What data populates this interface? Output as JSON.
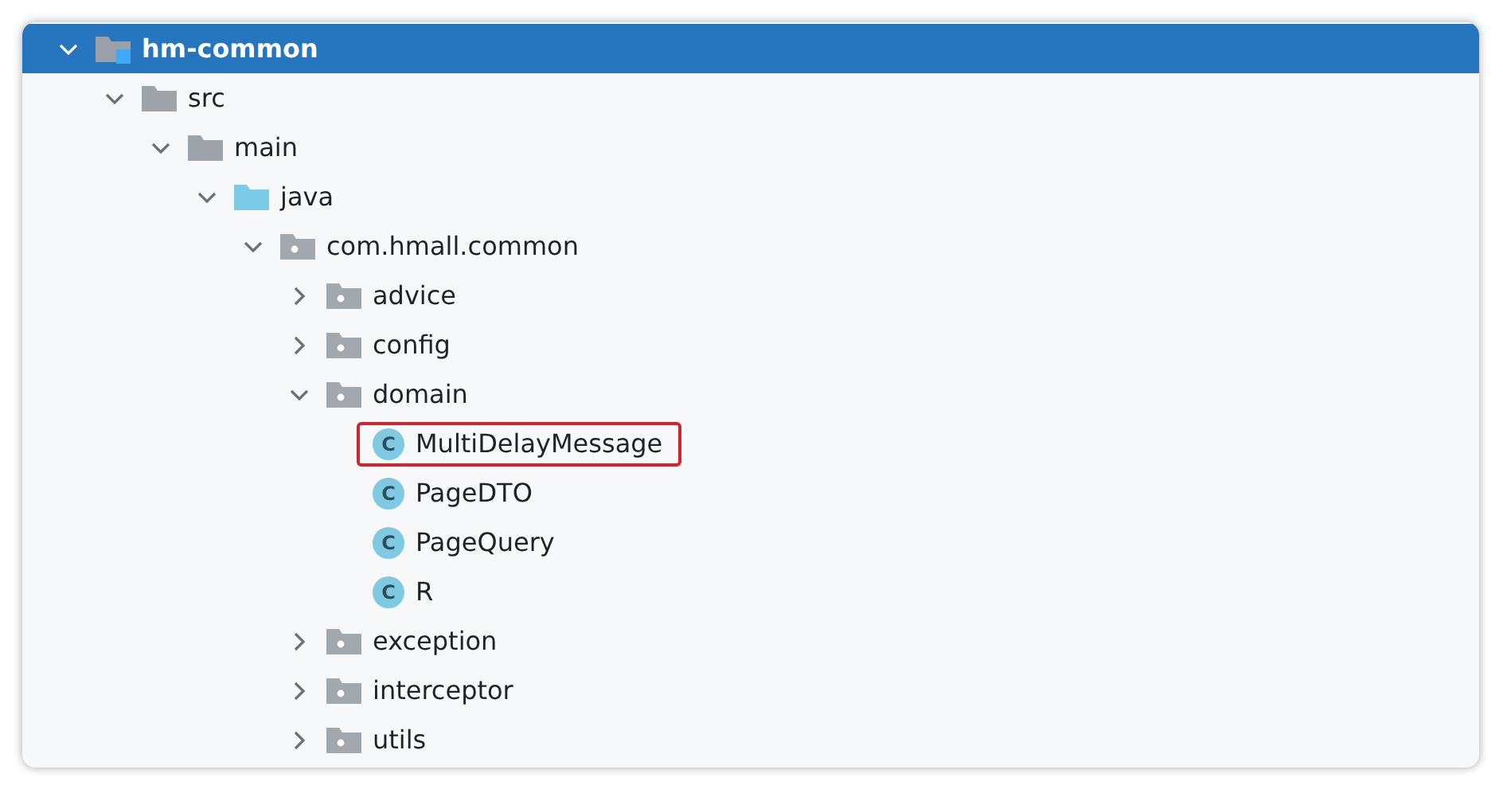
{
  "project_tree": {
    "root": {
      "kind": "module",
      "name": "hm-common",
      "expanded": true,
      "selected": true,
      "children": [
        {
          "kind": "folder",
          "name": "src",
          "expanded": true,
          "selected": false,
          "children": [
            {
              "kind": "folder",
              "name": "main",
              "expanded": true,
              "selected": false,
              "children": [
                {
                  "kind": "source_root",
                  "name": "java",
                  "expanded": true,
                  "selected": false,
                  "children": [
                    {
                      "kind": "package",
                      "name": "com.hmall.common",
                      "expanded": true,
                      "selected": false,
                      "children": [
                        {
                          "kind": "package",
                          "name": "advice",
                          "expanded": false,
                          "selected": false
                        },
                        {
                          "kind": "package",
                          "name": "config",
                          "expanded": false,
                          "selected": false
                        },
                        {
                          "kind": "package",
                          "name": "domain",
                          "expanded": true,
                          "selected": false,
                          "children": [
                            {
                              "kind": "class",
                              "badge": "C",
                              "name": "MultiDelayMessage",
                              "selected": false,
                              "highlighted": true
                            },
                            {
                              "kind": "class",
                              "badge": "C",
                              "name": "PageDTO",
                              "selected": false,
                              "highlighted": false
                            },
                            {
                              "kind": "class",
                              "badge": "C",
                              "name": "PageQuery",
                              "selected": false,
                              "highlighted": false
                            },
                            {
                              "kind": "class",
                              "badge": "C",
                              "name": "R",
                              "selected": false,
                              "highlighted": false
                            }
                          ]
                        },
                        {
                          "kind": "package",
                          "name": "exception",
                          "expanded": false,
                          "selected": false
                        },
                        {
                          "kind": "package",
                          "name": "interceptor",
                          "expanded": false,
                          "selected": false
                        },
                        {
                          "kind": "package",
                          "name": "utils",
                          "expanded": false,
                          "selected": false
                        }
                      ]
                    }
                  ]
                }
              ]
            }
          ]
        }
      ]
    }
  }
}
